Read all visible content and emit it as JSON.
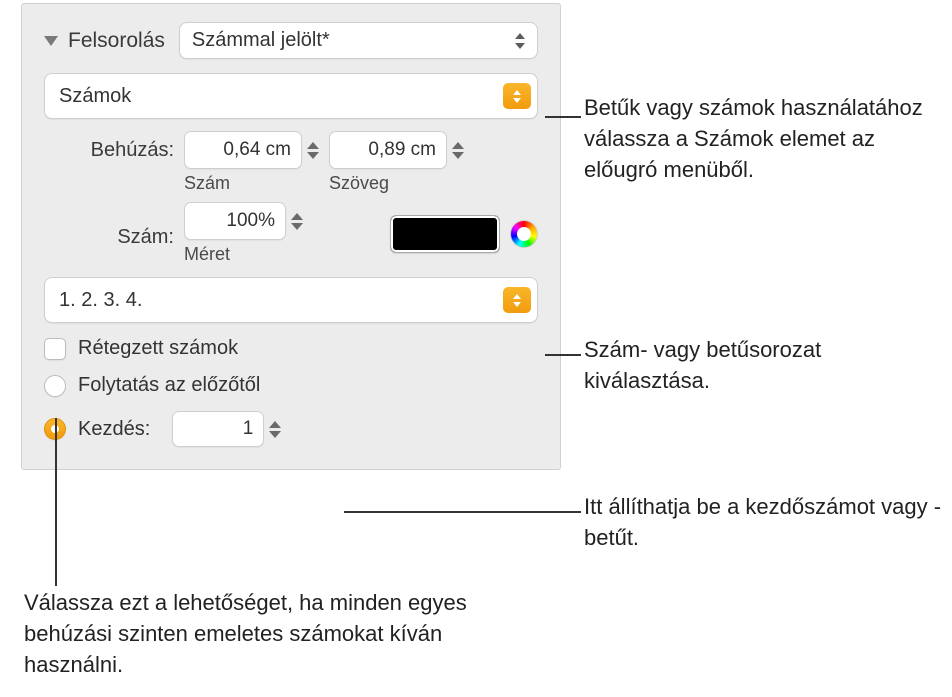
{
  "header": {
    "title": "Felsorolás",
    "style_dropdown": "Számmal jelölt*"
  },
  "type_dropdown": "Számok",
  "indent": {
    "label": "Behúzás:",
    "number_value": "0,64 cm",
    "number_sublabel": "Szám",
    "text_value": "0,89 cm",
    "text_sublabel": "Szöveg"
  },
  "size": {
    "label": "Szám:",
    "value": "100%",
    "sublabel": "Méret"
  },
  "sequence_dropdown": "1. 2. 3. 4.",
  "tiered_checkbox_label": "Rétegzett számok",
  "continue_radio_label": "Folytatás az előzőtől",
  "start_radio_label": "Kezdés:",
  "start_value": "1",
  "callouts": {
    "c1": "Betűk vagy számok használatához válassza a Számok elemet az előugró menüből.",
    "c2": "Szám- vagy betűsorozat kiválasztása.",
    "c3": "Itt állíthatja be a kezdőszámot vagy -betűt.",
    "c4": "Válassza ezt a lehetőséget, ha minden egyes behúzási szinten emeletes számokat kíván használni."
  }
}
